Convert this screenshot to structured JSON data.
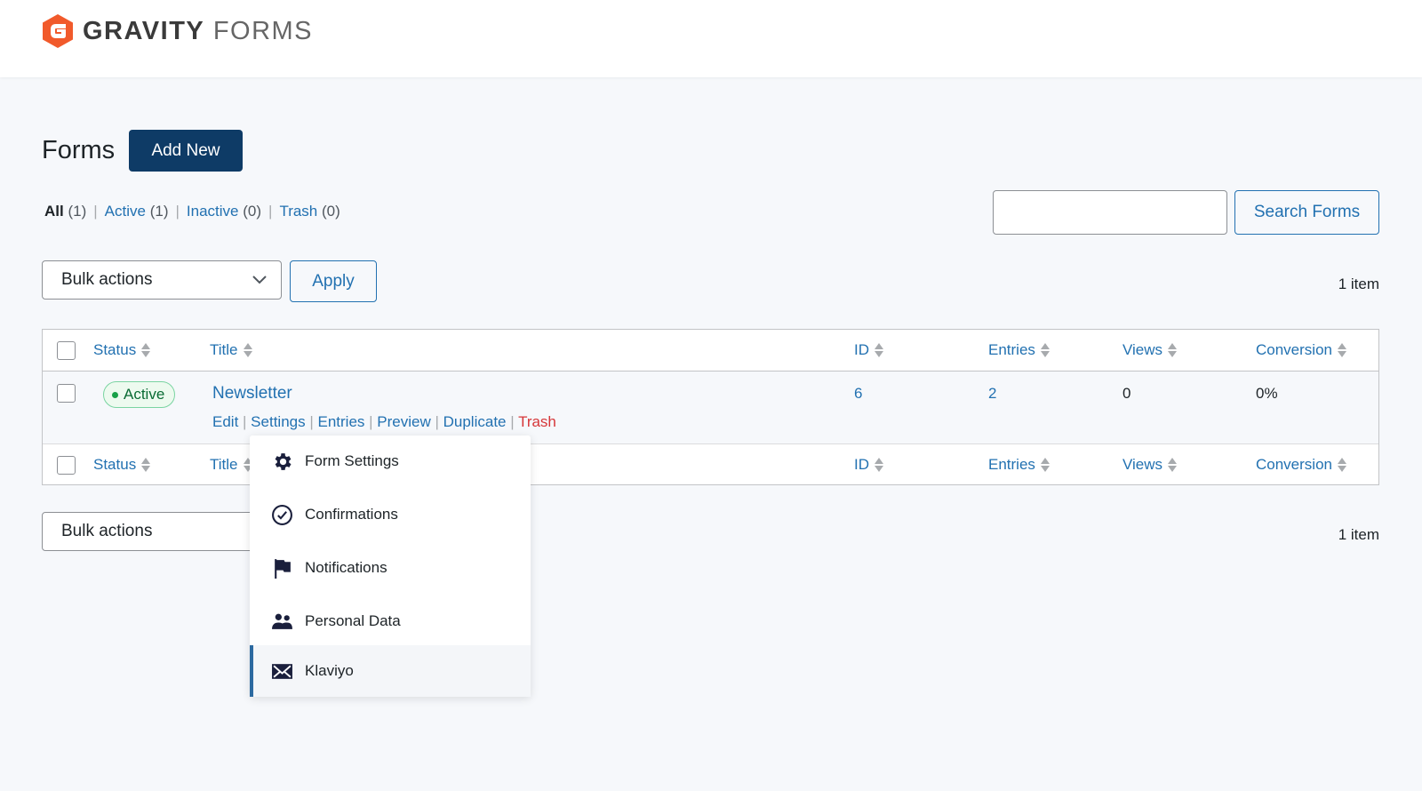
{
  "brand": {
    "name_bold": "GRAVITY",
    "name_light": "FORMS",
    "accent": "#f15a2b"
  },
  "page": {
    "title": "Forms",
    "add_new": "Add New"
  },
  "filters": [
    {
      "label": "All",
      "count": "(1)"
    },
    {
      "label": "Active",
      "count": "(1)"
    },
    {
      "label": "Inactive",
      "count": "(0)"
    },
    {
      "label": "Trash",
      "count": "(0)"
    }
  ],
  "search": {
    "value": "",
    "button": "Search Forms"
  },
  "bulk": {
    "selected": "Bulk actions",
    "apply": "Apply",
    "count": "1 item"
  },
  "columns": {
    "status": "Status",
    "title": "Title",
    "id": "ID",
    "entries": "Entries",
    "views": "Views",
    "conversion": "Conversion"
  },
  "rows": [
    {
      "status": "Active",
      "title": "Newsletter",
      "id": "6",
      "entries": "2",
      "views": "0",
      "conversion": "0%",
      "actions": {
        "edit": "Edit",
        "settings": "Settings",
        "entries": "Entries",
        "preview": "Preview",
        "duplicate": "Duplicate",
        "trash": "Trash"
      }
    }
  ],
  "settings_menu": [
    {
      "label": "Form Settings",
      "icon": "gear-icon"
    },
    {
      "label": "Confirmations",
      "icon": "check-circle-icon"
    },
    {
      "label": "Notifications",
      "icon": "flag-icon"
    },
    {
      "label": "Personal Data",
      "icon": "users-icon"
    },
    {
      "label": "Klaviyo",
      "icon": "envelope-icon"
    }
  ]
}
